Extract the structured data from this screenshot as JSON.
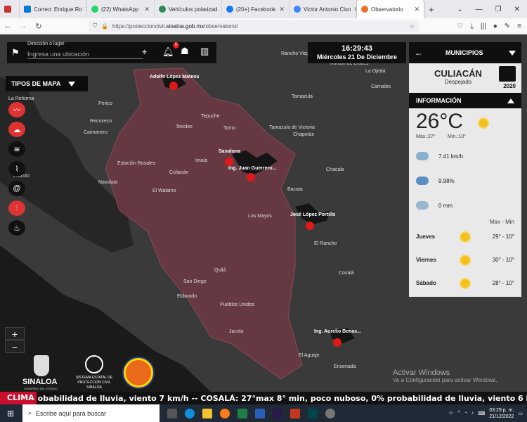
{
  "browser": {
    "tabs": [
      {
        "label": "Correo: Enrique Ro",
        "color": "#0078d4"
      },
      {
        "label": "(22) WhatsApp",
        "color": "#25d366"
      },
      {
        "label": "Vehículos polarizad",
        "color": "#2e8b57"
      },
      {
        "label": "(20+) Facebook",
        "color": "#1877f2"
      },
      {
        "label": "Victor Antonio Cisn",
        "color": "#4285f4"
      },
      {
        "label": "Observatorio",
        "color": "#e8742a",
        "active": true
      }
    ],
    "new_tab": "+",
    "url_prefix": "https://proteccioncivil.",
    "url_host": "sinaloa.gob.mx",
    "url_path": "/observatorio/"
  },
  "search": {
    "label": "Dirección o lugar",
    "placeholder": "Ingresa una ubicación",
    "notification_count": "0"
  },
  "map_types": {
    "title": "TIPOS DE MAPA",
    "layers": [
      {
        "icon": "rain-layer-icon",
        "color": "#d33"
      },
      {
        "icon": "cloud-layer-icon",
        "color": "#d33"
      },
      {
        "icon": "wind-layer-icon",
        "color": "#111"
      },
      {
        "icon": "pulse-layer-icon",
        "color": "#111"
      },
      {
        "icon": "hurricane-layer-icon",
        "color": "#111"
      },
      {
        "icon": "hazard-layer-icon",
        "color": "#d33"
      },
      {
        "icon": "fire-layer-icon",
        "color": "#111"
      }
    ]
  },
  "clock": {
    "time": "16:29:43",
    "date": "Miércoles 21 De Diciembre"
  },
  "sidebar": {
    "header": "MUNICIPIOS",
    "city": "CULIACÁN",
    "condition": "Despejado",
    "year": "2020",
    "info_header": "INFORMACIÓN",
    "temperature": "26°C",
    "max": "Máx.:27°",
    "min": "Mín.:10°",
    "wind": "7.41 km/h",
    "humidity": "9.98%",
    "rain": "0 mm",
    "maxmin_label": "Max - Min",
    "forecast": [
      {
        "day": "Jueves",
        "range": "29° - 10°"
      },
      {
        "day": "Viernes",
        "range": "30° - 10°"
      },
      {
        "day": "Sábado",
        "range": "28° - 10°"
      }
    ]
  },
  "map_labels": {
    "places": [
      "Adolfo López Mateos",
      "Sanalona",
      "Ing. Juan Guerrero...",
      "José López Portillo",
      "Ing. Aurelio Benas...",
      "Culiacán",
      "Tamazula de Victoria",
      "Rancho Viejo",
      "Rincón de Lruces",
      "La Ojeda",
      "Tecoles",
      "Tomo",
      "Caimanero",
      "La Reforma",
      "Recoveco",
      "Perico",
      "Estación Rosales",
      "Navolato",
      "Eldorado",
      "Quilá",
      "Cosalá",
      "San Diego",
      "Pueblos Unidos",
      "Jacola",
      "Ensenada",
      "El Aguaje",
      "Chacala",
      "Bacata",
      "El Walamo",
      "Tepuche",
      "Imala",
      "Vitaruto",
      "Los Mayos",
      "El Rancho",
      "Carnales",
      "Tamazula",
      "Chapotán"
    ]
  },
  "zoom": {
    "in": "+",
    "out": "−"
  },
  "logos": {
    "sinaloa": "SINALOA",
    "sinaloa_sub": "GOBIERNO DEL ESTADO",
    "sepc_line1": "SISTEMA ESTATAL DE",
    "sepc_line2": "PROTECCIÓN CIVIL",
    "sepc_line3": "SINALOA"
  },
  "watermark": {
    "line1": "Activar Windows",
    "line2": "Ve a Configuración para activar Windows."
  },
  "ticker": {
    "label": "CLIMA",
    "text": "obabilidad de lluvia, viento 7 km/h -- COSALÁ: 27°max 8° min, poco nuboso, 0% probabilidad de lluvia, viento 6 km/h -- CONCORDIA:"
  },
  "taskbar": {
    "search_placeholder": "Escribe aquí para buscar",
    "time": "03:29 p. m.",
    "date": "21/12/2022"
  }
}
